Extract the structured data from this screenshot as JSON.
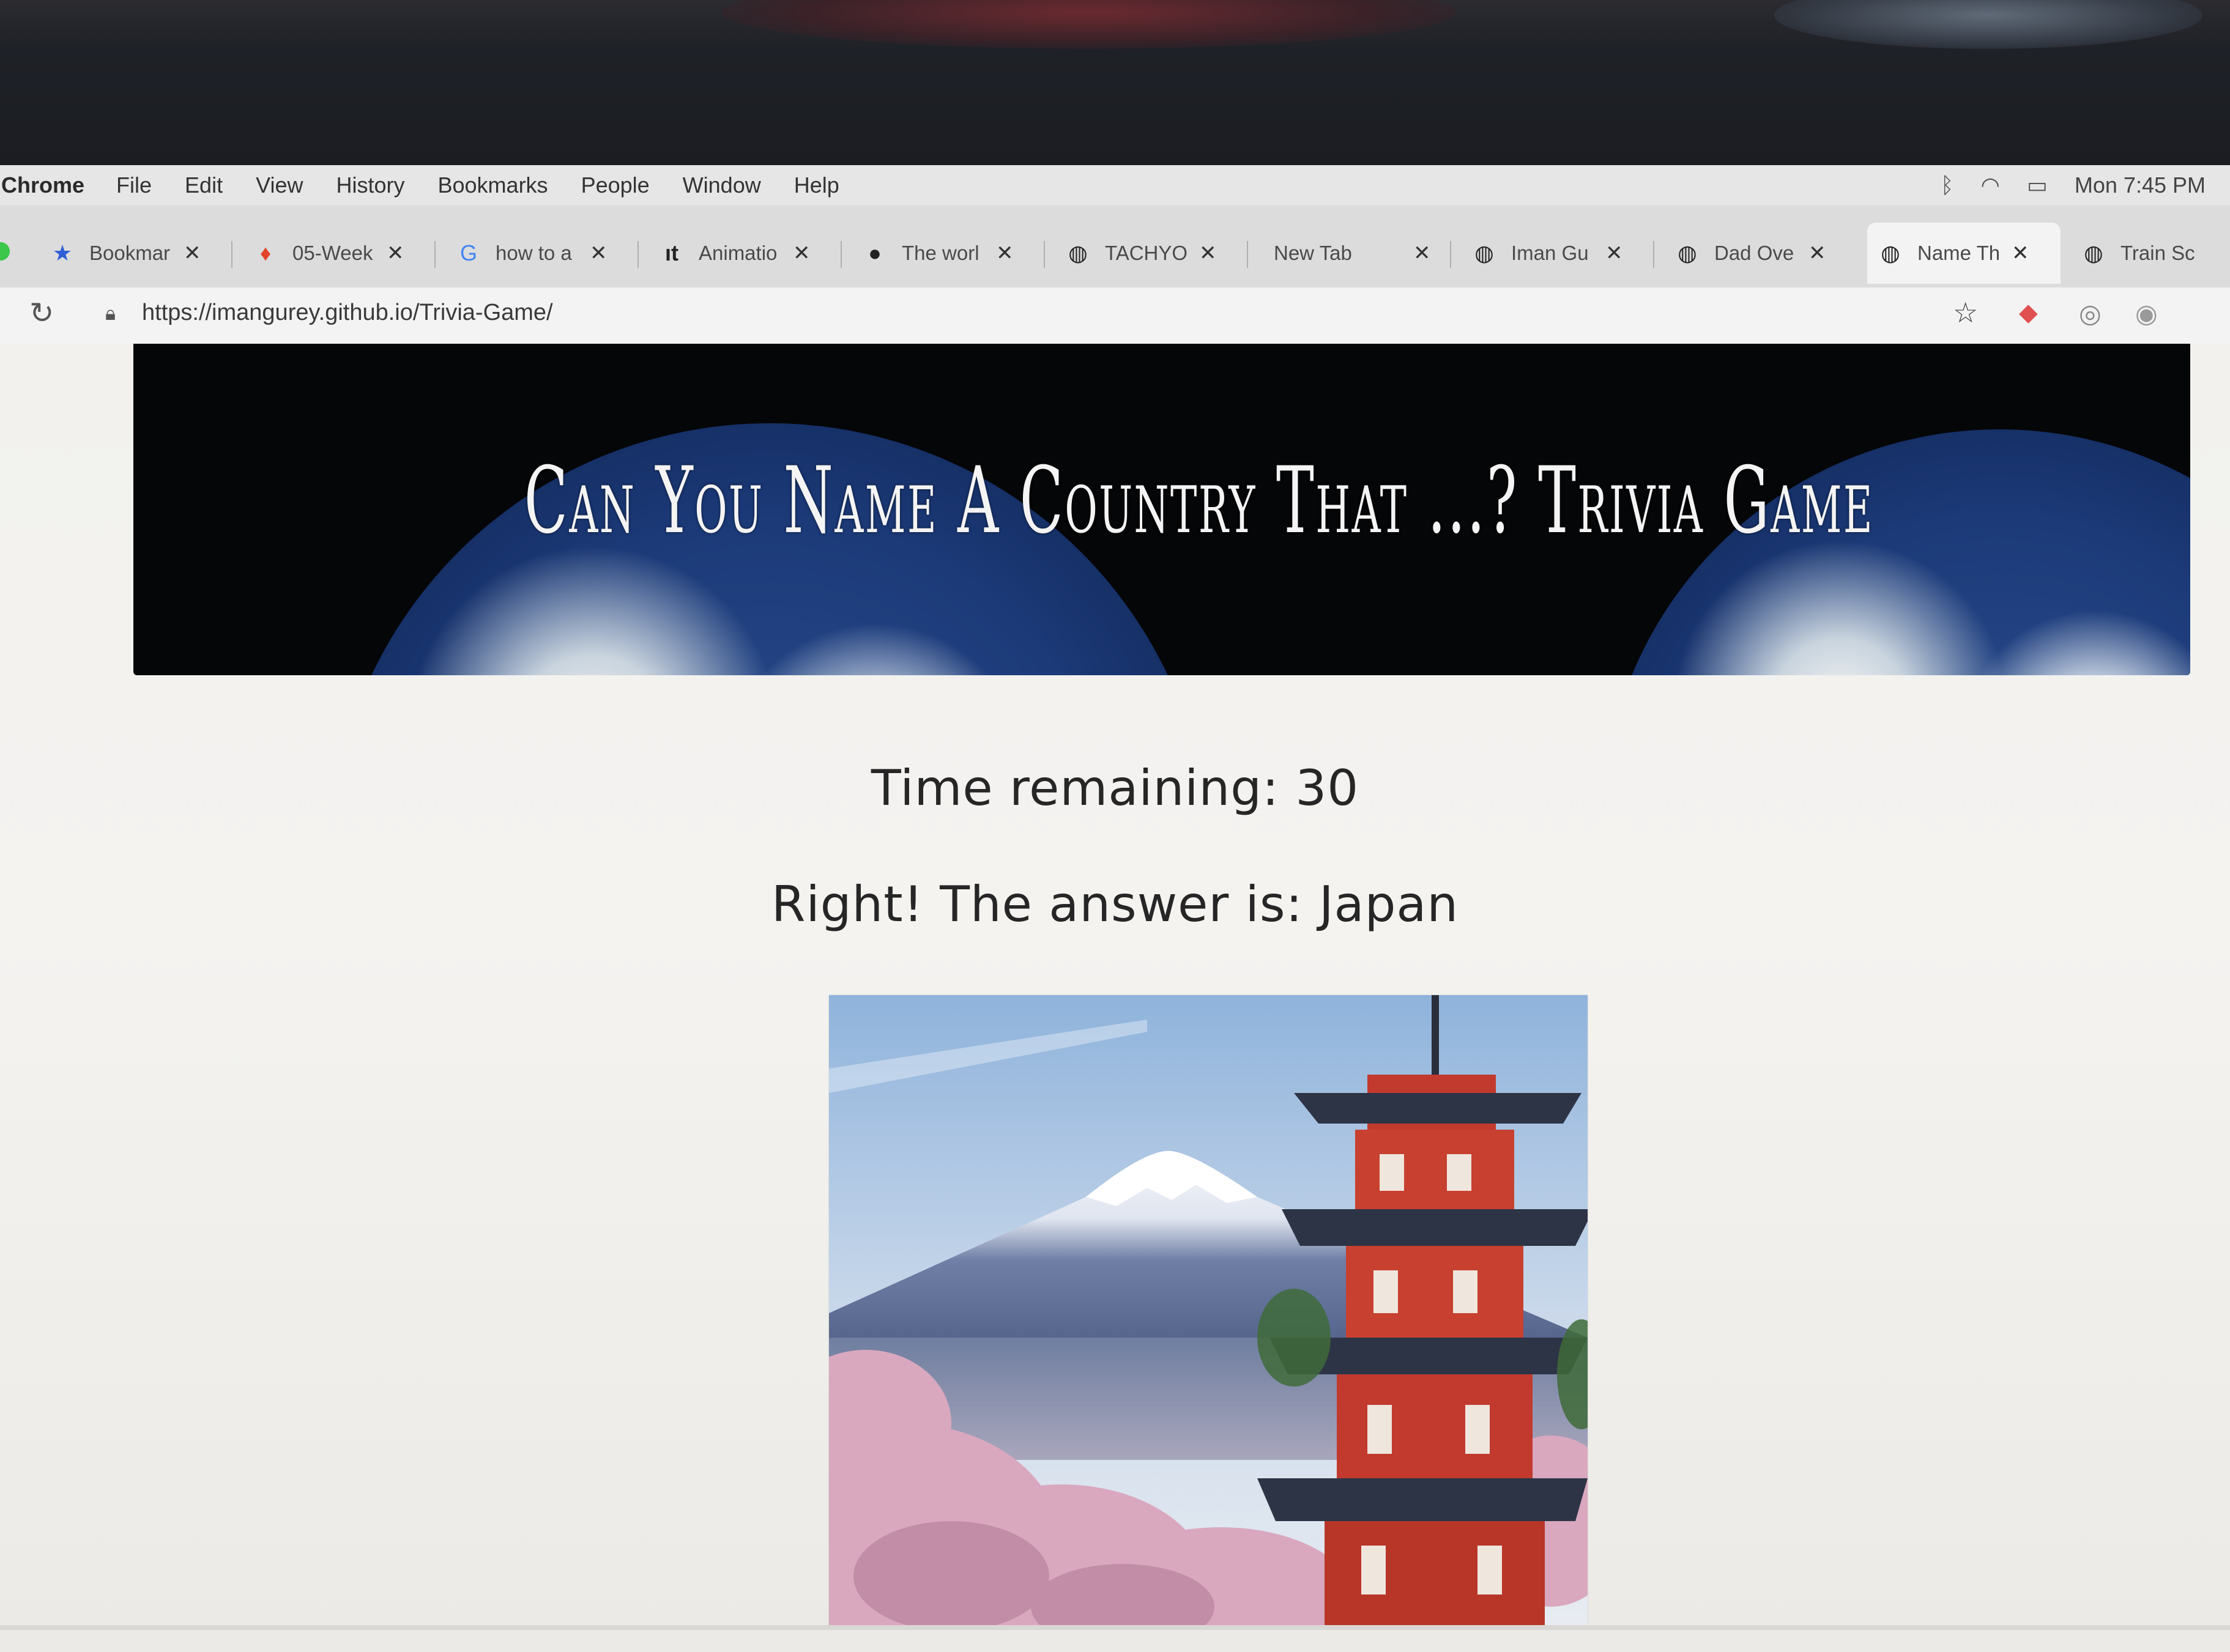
{
  "menubar": {
    "app": "Chrome",
    "items": [
      "File",
      "Edit",
      "View",
      "History",
      "Bookmarks",
      "People",
      "Window",
      "Help"
    ],
    "clock": "Mon 7:45 PM"
  },
  "tabs": [
    {
      "icon": "star-icon",
      "label": "Bookmar"
    },
    {
      "icon": "gitlab-icon",
      "label": "05-Week"
    },
    {
      "icon": "google-icon",
      "label": "how to a"
    },
    {
      "icon": "site-icon",
      "label": "Animatio"
    },
    {
      "icon": "github-icon",
      "label": "The worl"
    },
    {
      "icon": "globe-icon",
      "label": "TACHYO"
    },
    {
      "icon": "none",
      "label": "New Tab"
    },
    {
      "icon": "globe-icon",
      "label": "Iman Gu"
    },
    {
      "icon": "globe-icon",
      "label": "Dad Ove"
    },
    {
      "icon": "globe-icon",
      "label": "Name Th"
    },
    {
      "icon": "globe-icon",
      "label": "Train Sc"
    }
  ],
  "address_bar": {
    "url": "https://imangurey.github.io/Trivia-Game/"
  },
  "game": {
    "title": "Can You Name A Country That ...? Trivia Game",
    "timer": "Time remaining: 30",
    "result": "Right! The answer is: Japan"
  },
  "colors": {
    "page_background": "#f2f1ee",
    "banner_background": "#050608",
    "text": "#262626"
  }
}
